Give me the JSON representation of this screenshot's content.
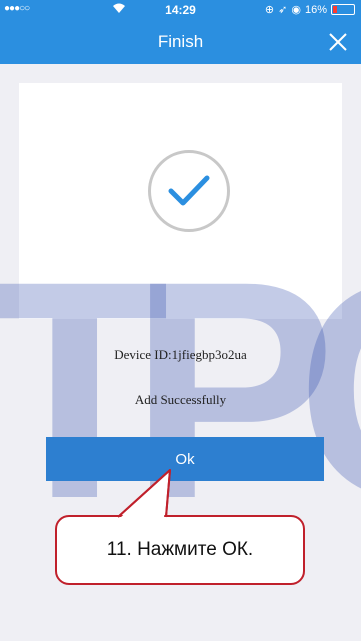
{
  "status_bar": {
    "signal": "●●●○○",
    "time": "14:29",
    "battery_percent": "16%",
    "icons": [
      "wifi-icon",
      "location-icon",
      "alarm-icon",
      "battery-icon"
    ]
  },
  "navbar": {
    "title": "Finish",
    "close_icon": "close-icon"
  },
  "result": {
    "icon": "checkmark-icon",
    "device_id": "Device ID:1jfiegbp3o2ua",
    "message": "Add Successfully"
  },
  "ok_label": "Ok",
  "annotation": {
    "text": "11. Нажмите ОК."
  },
  "watermark": "TPC",
  "colors": {
    "accent": "#2b8fe0",
    "button": "#2d7fd0",
    "callout_border": "#c0202b",
    "check": "#2b8fe0"
  }
}
